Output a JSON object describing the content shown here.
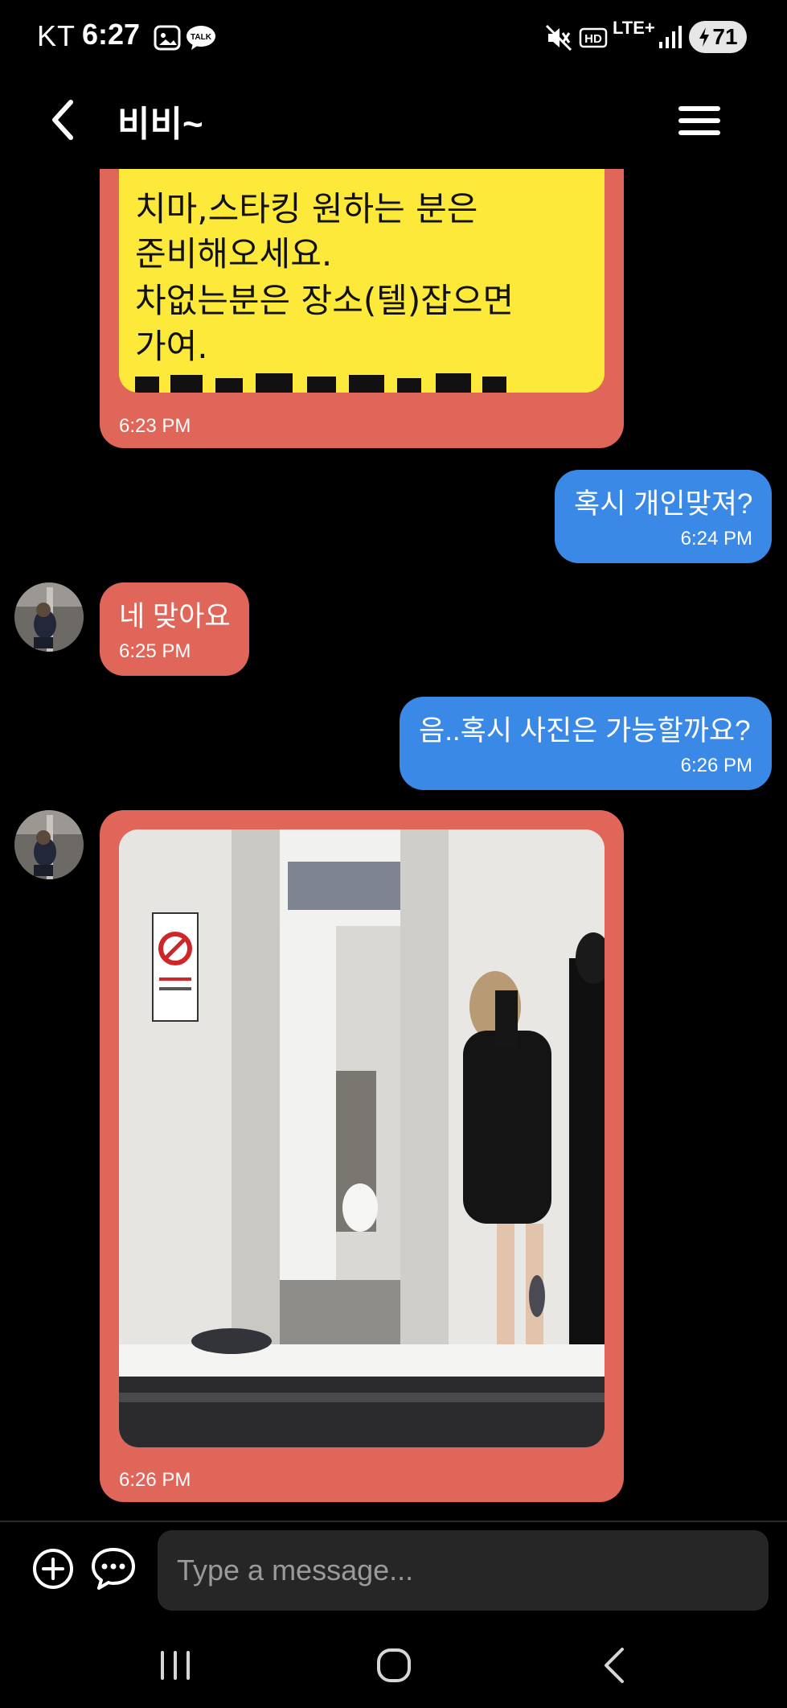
{
  "status_bar": {
    "carrier": "KT",
    "time": "6:27",
    "battery": "71",
    "network": "LTE+",
    "hd_label": "HD",
    "icons": [
      "gallery-icon",
      "talk-icon",
      "mute-icon",
      "hd-voice-icon",
      "lte-icon",
      "signal-icon",
      "battery-charging-icon"
    ]
  },
  "header": {
    "title": "비비~",
    "back_icon": "chevron-left-icon",
    "menu_icon": "hamburger-menu-icon"
  },
  "messages": [
    {
      "direction": "incoming",
      "type": "image-text",
      "lines": [
        "치마,스타킹 원하는 분은",
        "준비해오세요.",
        "차없는분은 장소(텔)잡으면",
        "가여."
      ],
      "time": "6:23 PM"
    },
    {
      "direction": "outgoing",
      "text": "혹시 개인맞져?",
      "time": "6:24 PM"
    },
    {
      "direction": "incoming",
      "text": "네 맞아요",
      "time": "6:25 PM"
    },
    {
      "direction": "outgoing",
      "text": "음..혹시 사진은 가능할까요?",
      "time": "6:26 PM"
    },
    {
      "direction": "incoming",
      "type": "photo",
      "time": "6:26 PM"
    }
  ],
  "composer": {
    "placeholder": "Type a message...",
    "add_icon": "plus-circle-icon",
    "chat_icon": "chat-bubble-icon"
  },
  "navbar": {
    "icons": [
      "recent-apps-icon",
      "home-icon",
      "back-icon"
    ]
  },
  "colors": {
    "incoming_bubble": "#e0665a",
    "outgoing_bubble": "#3a89e6",
    "notice_background": "#fde93a",
    "background": "#000000"
  }
}
